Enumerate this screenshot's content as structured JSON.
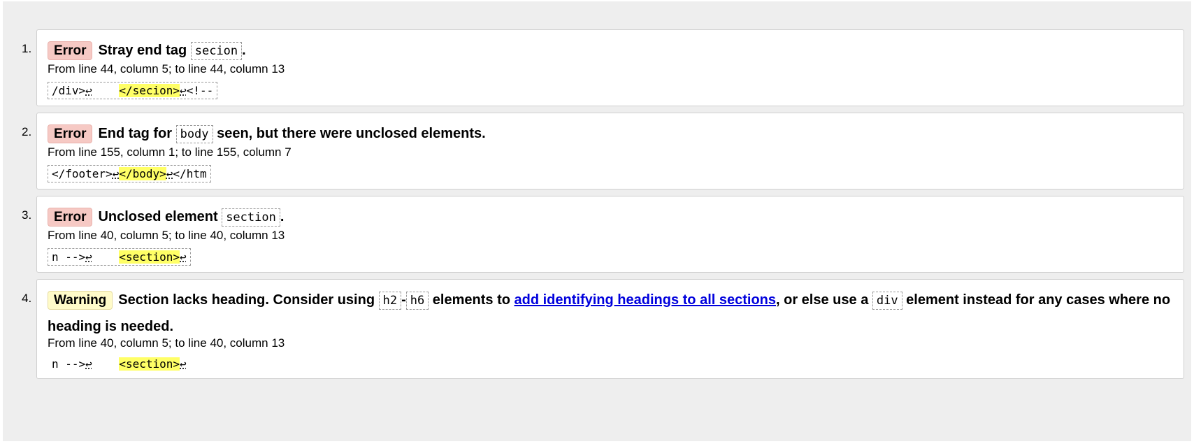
{
  "results": [
    {
      "number": "1.",
      "type": "Error",
      "msg_before": "Stray end tag ",
      "code": "secion",
      "msg_after": ".",
      "location": "From line 44, column 5; to line 44, column 13",
      "extract_pre": "/div>",
      "extract_lb1": "↩",
      "extract_mid": "    ",
      "extract_highlight": "</secion>",
      "extract_lb2": "↩",
      "extract_post": "<!--"
    },
    {
      "number": "2.",
      "type": "Error",
      "msg_before": "End tag for ",
      "code": "body",
      "msg_after": " seen, but there were unclosed elements.",
      "location": "From line 155, column 1; to line 155, column 7",
      "extract_pre": "</footer>",
      "extract_lb1": "↩",
      "extract_mid": "",
      "extract_highlight": "</body>",
      "extract_lb2": "↩",
      "extract_post": "</htm"
    },
    {
      "number": "3.",
      "type": "Error",
      "msg_before": "Unclosed element ",
      "code": "section",
      "msg_after": ".",
      "location": "From line 40, column 5; to line 40, column 13",
      "extract_pre": "n -->",
      "extract_lb1": "↩",
      "extract_mid": "    ",
      "extract_highlight": "<section>",
      "extract_lb2": "↩",
      "extract_post": ""
    },
    {
      "number": "4.",
      "type": "Warning",
      "msg_before": "Section lacks heading. Consider using ",
      "code_a": "h2",
      "dash": "-",
      "code_b": "h6",
      "msg_mid": " elements to ",
      "link_text": "add identifying headings to all sections",
      "msg_mid2": ", or else use a ",
      "code_c": "div",
      "msg_after": " element instead for any cases where no heading is needed.",
      "location": "From line 40, column 5; to line 40, column 13",
      "extract_pre": "n -->",
      "extract_lb1": "↩",
      "extract_mid": "    ",
      "extract_highlight": "<section>",
      "extract_lb2": "↩",
      "extract_post": ""
    }
  ],
  "colors": {
    "error_badge": "#f6c9c4",
    "warning_badge": "#fffbc9",
    "highlight": "#ffff66",
    "link": "#0000dd"
  }
}
